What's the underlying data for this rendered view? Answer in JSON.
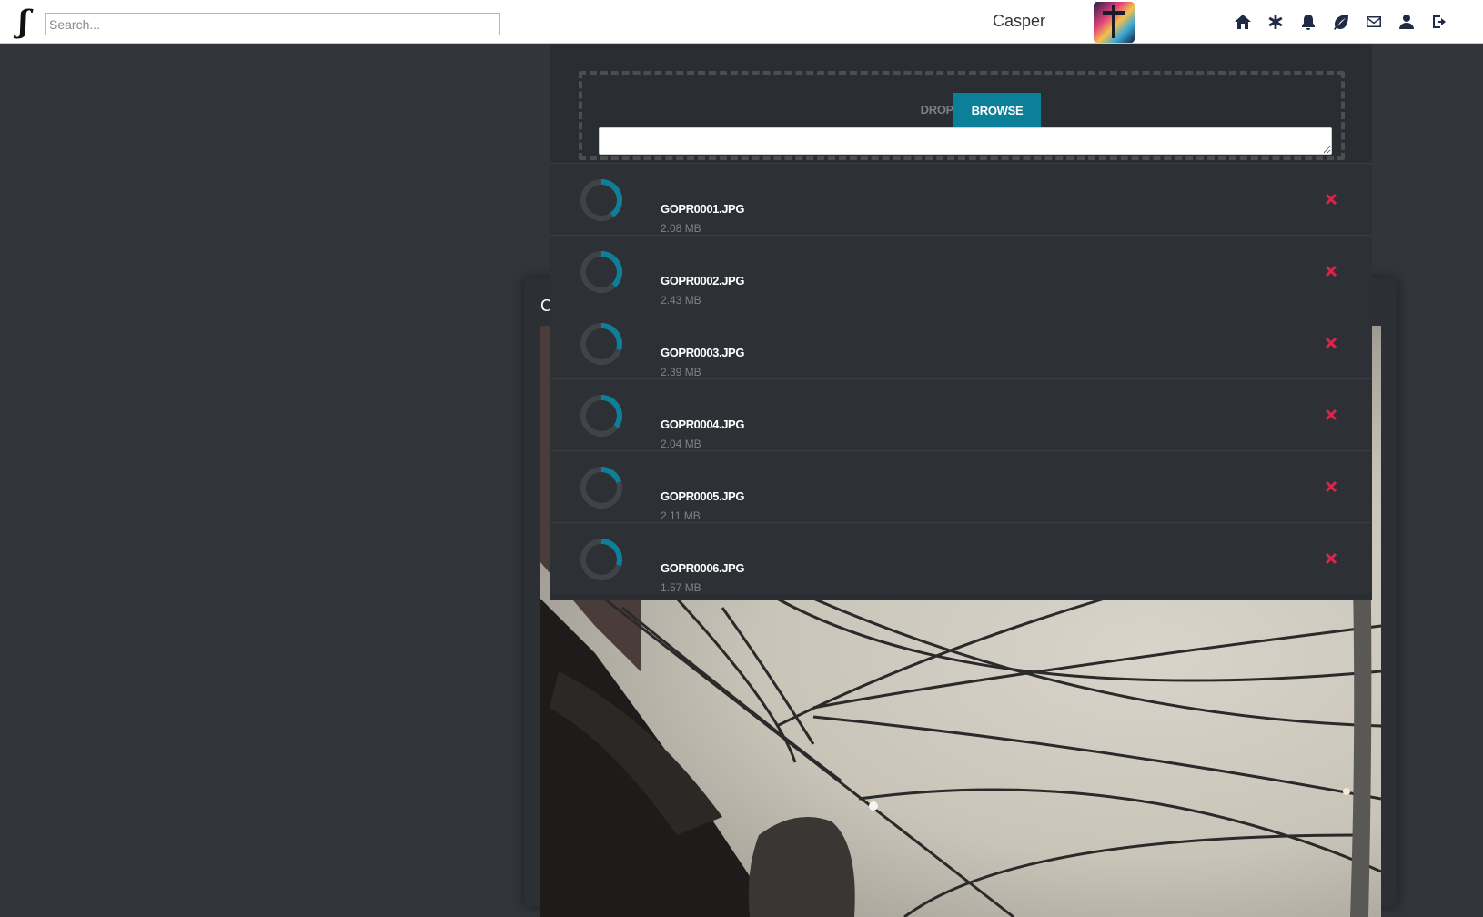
{
  "header": {
    "logo_glyph": "ʃ",
    "search": {
      "placeholder": "Search...",
      "value": ""
    },
    "username": "Casper",
    "nav": [
      {
        "name": "home-icon"
      },
      {
        "name": "asterisk-icon"
      },
      {
        "name": "bell-icon"
      },
      {
        "name": "leaf-icon"
      },
      {
        "name": "envelope-icon"
      },
      {
        "name": "user-icon"
      },
      {
        "name": "logout-icon"
      }
    ]
  },
  "card": {
    "letter": "C"
  },
  "upload": {
    "drop_label": "DROP HERE",
    "browse_label": "BROWSE",
    "files": [
      {
        "name": "GOPR0001.JPG",
        "size": "2.08 MB",
        "progress": 0.4
      },
      {
        "name": "GOPR0002.JPG",
        "size": "2.43 MB",
        "progress": 0.38
      },
      {
        "name": "GOPR0003.JPG",
        "size": "2.39 MB",
        "progress": 0.3
      },
      {
        "name": "GOPR0004.JPG",
        "size": "2.04 MB",
        "progress": 0.35
      },
      {
        "name": "GOPR0005.JPG",
        "size": "2.11 MB",
        "progress": 0.2
      },
      {
        "name": "GOPR0006.JPG",
        "size": "1.57 MB",
        "progress": 0.3
      }
    ]
  },
  "colors": {
    "accent": "#0d8099",
    "remove": "#e0234a",
    "spinner_track": "#404449"
  }
}
